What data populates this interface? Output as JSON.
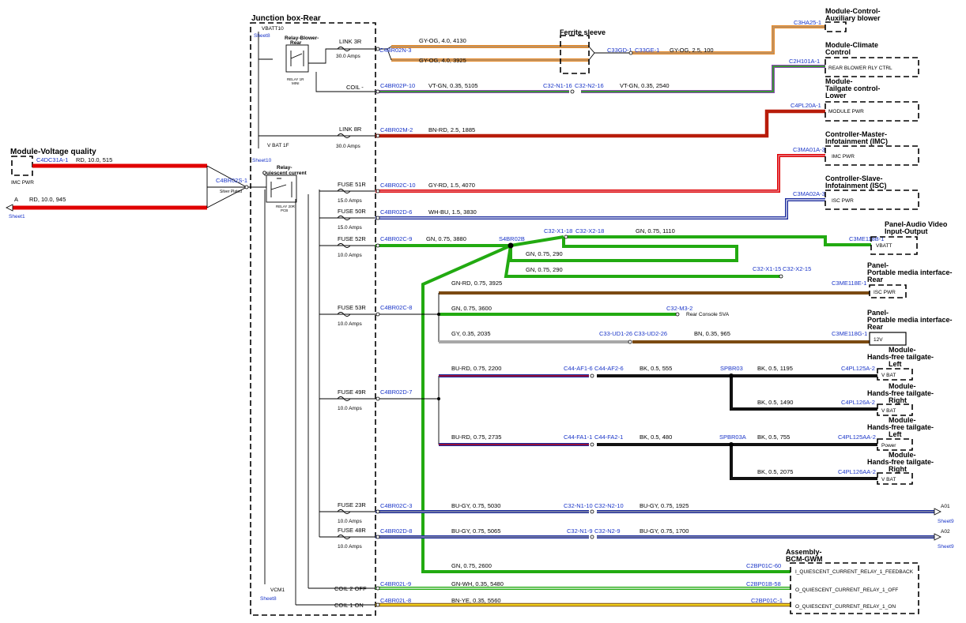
{
  "junction_box": {
    "title": "Junction box-Rear",
    "vbatt_top": "VBATT10",
    "vbatt_top_sheet": "Sheet8",
    "vbat_1f": "V BAT 1F",
    "vbat_1f_sheet": "Sheet10",
    "vcm1": "VCM1",
    "vcm1_sheet": "Sheet8",
    "relay_blower_title": "Relay-Blower-\nRear",
    "relay_blower_sub": "RELAY 1R\nMINI",
    "relay_quiescent_title": "Relay-\nQuiescent current",
    "relay_quiescent_sub": "RELAY 20R\nPCB"
  },
  "left": {
    "module_title": "Module-Voltage quality",
    "imc_pwr": "IMC PWR",
    "c_top": "C4DC31A-1",
    "wire_top": "RD, 10.0, 515",
    "pin_a": "A",
    "wire_bottom": "RD, 10.0, 945",
    "sheet1": "Sheet1",
    "splice": "C4BR02S-1",
    "splice_note": "Silver Plated"
  },
  "fuses": [
    {
      "name": "LINK 3R",
      "amps": "30.0 Amps"
    },
    {
      "name": "LINK 8R",
      "amps": "30.0 Amps"
    },
    {
      "name": "FUSE 51R",
      "amps": "15.0 Amps"
    },
    {
      "name": "FUSE 50R",
      "amps": "15.0 Amps"
    },
    {
      "name": "FUSE 52R",
      "amps": "10.0 Amps"
    },
    {
      "name": "FUSE 53R",
      "amps": "10.0 Amps"
    },
    {
      "name": "FUSE 49R",
      "amps": "10.0 Amps"
    },
    {
      "name": "FUSE 23R",
      "amps": "10.0 Amps"
    },
    {
      "name": "FUSE 48R",
      "amps": "10.0 Amps"
    }
  ],
  "coil_minus": "COIL -",
  "coil2": "COIL 2 OFF",
  "coil1": "COIL 1 ON",
  "connectors": {
    "c1": "C4BR02N-3",
    "c2": "C4BR02P-10",
    "c3": "C4BR02M-2",
    "c4": "C4BR02C-10",
    "c5": "C4BR02D-6",
    "c6": "C4BR02C-9",
    "c7": "C4BR02C-8",
    "c8": "C4BR02D-7",
    "c9": "C4BR02C-3",
    "c10": "C4BR02D-8",
    "c11": "C4BR02L-9",
    "c12": "C4BR02L-8",
    "c33gd": "C33GD-1",
    "c33ge": "C33GE-1",
    "c32n116": "C32-N1-16",
    "c32n216": "C32-N2-16",
    "s4br02b": "S4BR02B",
    "c32x118": "C32-X1-18",
    "c32x218": "C32-X2-18",
    "c32x115": "C32-X1-15",
    "c32x215": "C32-X2-15",
    "c32m32": "C32-M3-2",
    "c33ud126": "C33-UD1-26",
    "c33ud226": "C33-UD2-26",
    "c44af16": "C44-AF1-6",
    "c44af26": "C44-AF2-6",
    "spbr03": "SPBR03",
    "c44fa11": "C44-FA1-1",
    "c44fa21": "C44-FA2-1",
    "spbr03a": "SPBR03A",
    "c32n110": "C32-N1-10",
    "c32n210": "C32-N2-10",
    "c32n19": "C32-N1-9",
    "c32n29": "C32-N2-9"
  },
  "ferrite": "Ferrite sleeve",
  "wires": {
    "w1a": "GY-OG, 4.0, 4130",
    "w1b": "GY-OG, 4.0, 3925",
    "w1c": "GY-OG, 2.5, 100",
    "w2a": "VT-GN, 0.35, 5105",
    "w2b": "VT-GN, 0.35, 2540",
    "w3": "BN-RD, 2.5, 1885",
    "w4": "GY-RD, 1.5, 4070",
    "w5": "WH-BU, 1.5, 3830",
    "w6": "GN, 0.75, 3880",
    "w6b": "GN, 0.75, 1110",
    "w6c": "GN, 0.75, 290",
    "w6d": "GN, 0.75, 290",
    "w7": "GN-RD, 0.75, 3925",
    "w8": "GN, 0.75, 3600",
    "rear_console": "Rear Console SVA",
    "w9a": "GY, 0.35, 2035",
    "w9b": "BN, 0.35, 965",
    "w10a": "BU-RD, 0.75, 2200",
    "w10b": "BK, 0.5, 555",
    "w10c": "BK, 0.5, 1195",
    "w10d": "BK, 0.5, 1490",
    "w11a": "BU-RD, 0.75, 2735",
    "w11b": "BK, 0.5, 480",
    "w11c": "BK, 0.5, 755",
    "w11d": "BK, 0.5, 2075",
    "w12a": "BU-GY, 0.75, 5030",
    "w12b": "BU-GY, 0.75, 1925",
    "w13a": "BU-GY, 0.75, 5065",
    "w13b": "BU-GY, 0.75, 1700",
    "w14": "GN, 0.75, 2600",
    "w15": "GN-WH, 0.35, 5480",
    "w16": "BN-YE, 0.35, 5560"
  },
  "modules": [
    {
      "title": "Module-Control-\nAuxiliary blower",
      "conn": "C3HA25-1",
      "pin": ""
    },
    {
      "title": "Module-Climate\nControl",
      "conn": "C2H101A-1",
      "pin": "REAR BLOWER RLY CTRL"
    },
    {
      "title": "Module-\nTailgate control-\nLower",
      "conn": "C4PL20A-1",
      "pin": "MODULE PWR"
    },
    {
      "title": "Controller-Master-\nInfotainment (IMC)",
      "conn": "C3MA01A-3",
      "pin": "IMC PWR"
    },
    {
      "title": "Controller-Slave-\nInfotainment (ISC)",
      "conn": "C3MA02A-3",
      "pin": "ISC PWR"
    },
    {
      "title": "Panel-Audio Video\nInput-Output",
      "conn": "C3ME118B-1",
      "pin": "VBATT"
    },
    {
      "title": "Panel-\nPortable media interface-\nRear",
      "conn": "C3ME118E-1",
      "pin": "ISC PWR"
    },
    {
      "title": "Panel-\nPortable media interface-\nRear",
      "conn": "C3ME118G-1",
      "pin": "12V"
    },
    {
      "title": "Module-\nHands-free tailgate-\nLeft",
      "conn": "C4PL125A-2",
      "pin": "V BAT"
    },
    {
      "title": "Module-\nHands-free tailgate-\nRight",
      "conn": "C4PL126A-2",
      "pin": "V BAT"
    },
    {
      "title": "Module-\nHands-free tailgate-\nLeft",
      "conn": "C4PL125AA-2",
      "pin": "Power"
    },
    {
      "title": "Module-\nHands-free tailgate-\nRight",
      "conn": "C4PL126AA-2",
      "pin": "V BAT"
    }
  ],
  "sheet_refs": [
    {
      "id": "A01",
      "sheet": "Sheet9"
    },
    {
      "id": "A02",
      "sheet": "Sheet9"
    }
  ],
  "bcm": {
    "title": "Assembly-\nBCM-GWM",
    "conns": [
      "C2BP01C-60",
      "C2BP01B-58",
      "C2BP01C-1"
    ],
    "pins": [
      "I_QUIESCENT_CURRENT_RELAY_1_FEEDBACK",
      "O_QUIESCENT_CURRENT_RELAY_1_OFF",
      "O_QUIESCENT_CURRENT_RELAY_1_ON"
    ]
  },
  "colors": {
    "orange": "#e58a2a",
    "red": "#e00000",
    "darkred": "#b81c0a",
    "green": "#22aa11",
    "navy": "#1a2a9c",
    "brown": "#7b4a12",
    "gray": "#a8a8a8",
    "black": "#111111",
    "yellow": "#f2cf1b",
    "purple": "#8a4bb0",
    "pink": "#e89aa6"
  }
}
